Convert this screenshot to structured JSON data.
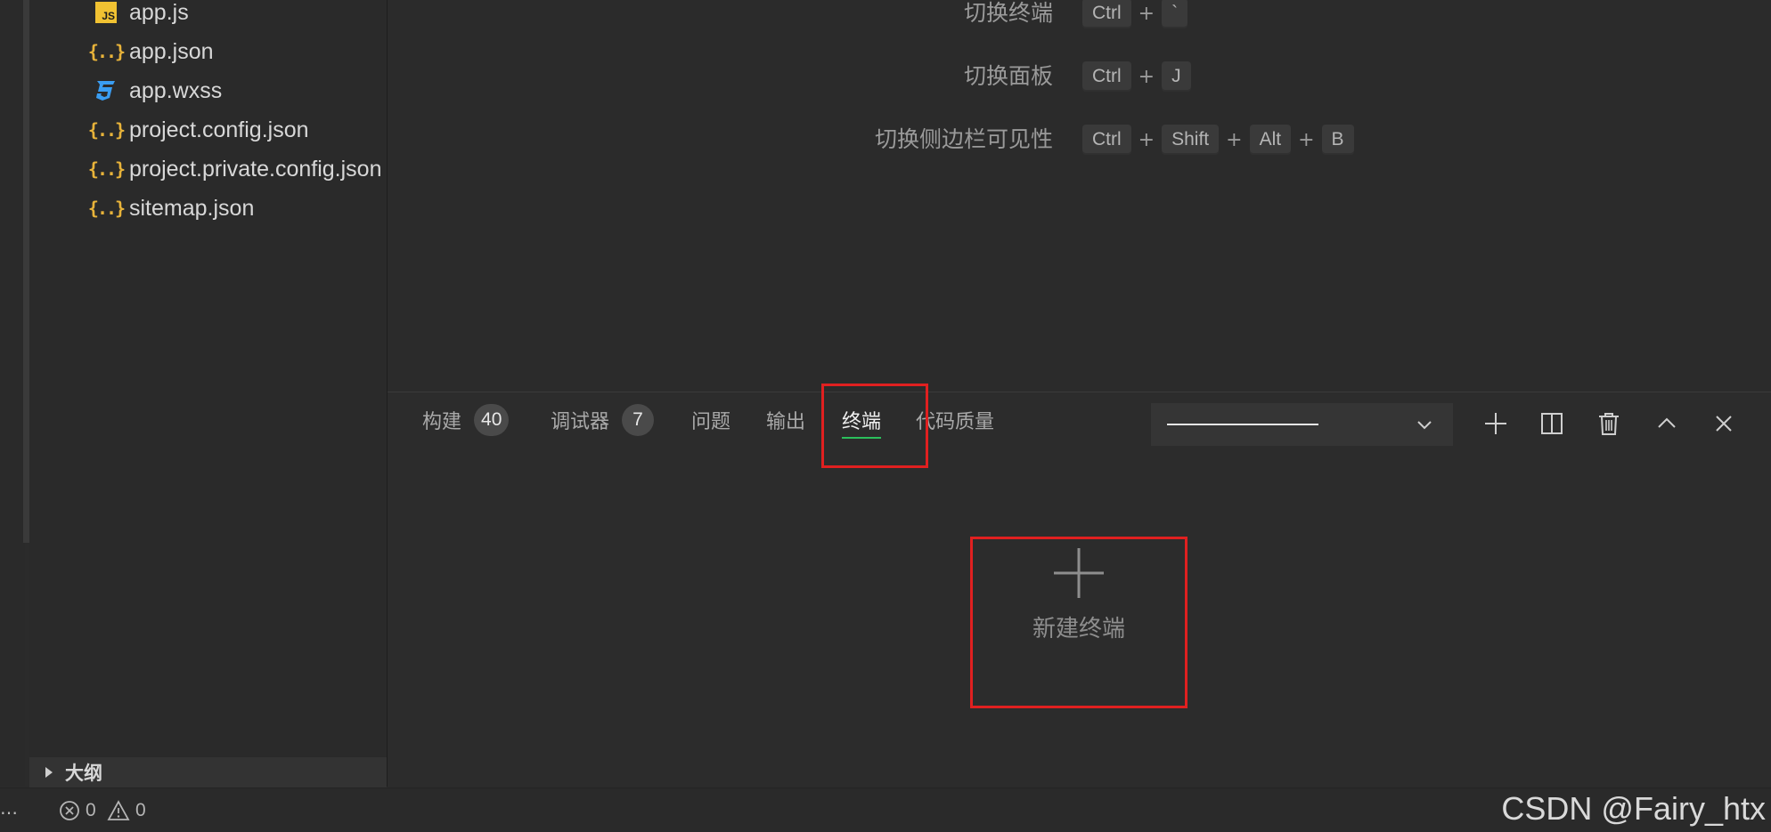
{
  "explorer": {
    "files": [
      {
        "name": "app.js",
        "icon": "js-file-icon"
      },
      {
        "name": "app.json",
        "icon": "json-file-icon"
      },
      {
        "name": "app.wxss",
        "icon": "css-file-icon"
      },
      {
        "name": "project.config.json",
        "icon": "json-file-icon"
      },
      {
        "name": "project.private.config.json",
        "icon": "json-file-icon"
      },
      {
        "name": "sitemap.json",
        "icon": "json-file-icon"
      }
    ],
    "outline_label": "大纲"
  },
  "shortcuts": [
    {
      "label": "切换终端",
      "keys": [
        "Ctrl",
        "`"
      ]
    },
    {
      "label": "切换面板",
      "keys": [
        "Ctrl",
        "J"
      ]
    },
    {
      "label": "切换侧边栏可见性",
      "keys": [
        "Ctrl",
        "Shift",
        "Alt",
        "B"
      ]
    }
  ],
  "panel": {
    "tabs": [
      {
        "label": "构建",
        "badge": "40"
      },
      {
        "label": "调试器",
        "badge": "7"
      },
      {
        "label": "问题"
      },
      {
        "label": "输出"
      },
      {
        "label": "终端",
        "active": true
      },
      {
        "label": "代码质量"
      }
    ],
    "actions": [
      "plus-icon",
      "split-icon",
      "trash-icon",
      "chevron-up-icon",
      "close-icon"
    ],
    "new_terminal_label": "新建终端"
  },
  "status": {
    "more": "…",
    "errors": "0",
    "warnings": "0"
  },
  "watermark": "CSDN @Fairy_htx",
  "colors": {
    "accent_green": "#2bbf5b",
    "highlight_red": "#e02020",
    "json_icon": "#e8b33a",
    "css_icon": "#3a9df2",
    "js_icon": "#f1c232"
  }
}
